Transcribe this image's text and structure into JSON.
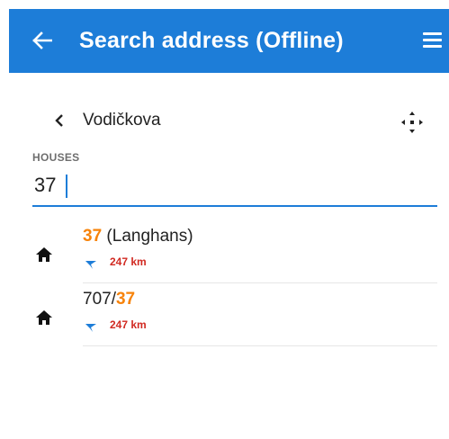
{
  "appbar": {
    "title": "Search address (Offline)",
    "back_icon": "arrow-left-icon",
    "menu_icon": "hamburger-menu-icon",
    "background": "#1d7dd8"
  },
  "street": {
    "name": "Vodičkova",
    "back_icon": "chevron-left-icon",
    "locate_icon": "crosshair-icon"
  },
  "houses": {
    "label": "HOUSES",
    "value": "37"
  },
  "results": [
    {
      "pre": "",
      "highlight": "37",
      "post": " (Langhans)",
      "distance": "247 km",
      "icon": "home-icon"
    },
    {
      "pre": "707/",
      "highlight": "37",
      "post": "",
      "distance": "247 km",
      "icon": "home-icon"
    }
  ],
  "colors": {
    "accent": "#1d7dd8",
    "highlight": "#f7830a",
    "distance": "#d12a22"
  }
}
